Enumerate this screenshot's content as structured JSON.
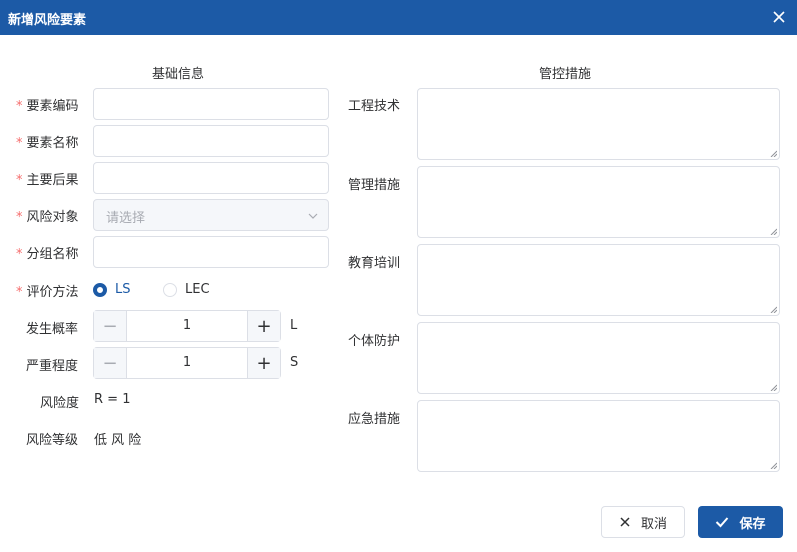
{
  "dialog": {
    "title": "新增风险要素"
  },
  "sections": {
    "basic": "基础信息",
    "control": "管控措施"
  },
  "form": {
    "code_label": "要素编码",
    "code_value": "",
    "name_label": "要素名称",
    "name_value": "",
    "consequence_label": "主要后果",
    "consequence_value": "",
    "object_label": "风险对象",
    "object_placeholder": "请选择",
    "group_label": "分组名称",
    "group_value": "",
    "method_label": "评价方法",
    "method_options": [
      "LS",
      "LEC"
    ],
    "method_selected": "LS",
    "probability_label": "发生概率",
    "probability_value": "1",
    "probability_unit": "L",
    "severity_label": "严重程度",
    "severity_value": "1",
    "severity_unit": "S",
    "risk_degree_label": "风险度",
    "risk_degree_value": "R = 1",
    "risk_level_label": "风险等级",
    "risk_level_value": "低 风 险"
  },
  "measures": [
    {
      "label": "工程技术",
      "value": ""
    },
    {
      "label": "管理措施",
      "value": ""
    },
    {
      "label": "教育培训",
      "value": ""
    },
    {
      "label": "个体防护",
      "value": ""
    },
    {
      "label": "应急措施",
      "value": ""
    }
  ],
  "buttons": {
    "cancel": "取消",
    "save": "保存"
  },
  "colors": {
    "primary": "#1c5aa6",
    "required": "#f56c6c"
  }
}
